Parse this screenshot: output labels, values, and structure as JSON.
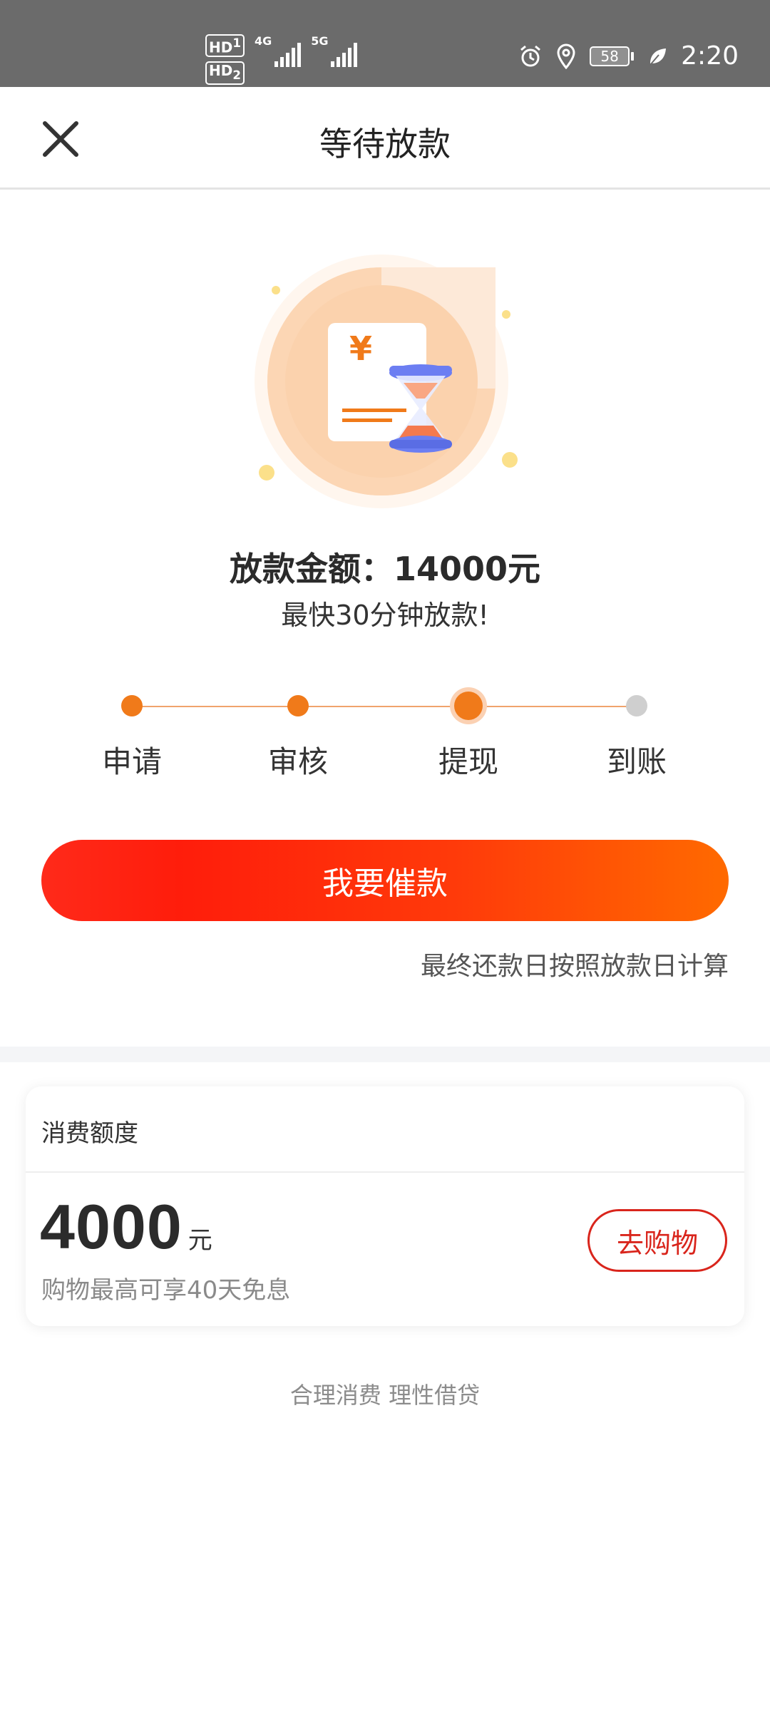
{
  "status_bar": {
    "hd1": "HD",
    "hd1_sub": "1",
    "hd2": "HD",
    "hd2_sub": "2",
    "net1": "4G",
    "net2": "5G",
    "battery": "58",
    "time": "2:20",
    "icons": [
      "alarm-icon",
      "location-icon",
      "battery-icon",
      "leaf-icon"
    ]
  },
  "header": {
    "title": "等待放款",
    "close_icon": "close-icon"
  },
  "loan": {
    "amount_title": "放款金额：14000元",
    "subtitle": "最快30分钟放款!",
    "illustration_symbol": "¥"
  },
  "steps": [
    {
      "label": "申请",
      "state": "done"
    },
    {
      "label": "审核",
      "state": "done"
    },
    {
      "label": "提现",
      "state": "current"
    },
    {
      "label": "到账",
      "state": "pending"
    }
  ],
  "actions": {
    "urge_label": "我要催款",
    "repay_note": "最终还款日按照放款日计算"
  },
  "credit": {
    "title": "消费额度",
    "amount": "4000",
    "unit": "元",
    "desc": "购物最高可享40天免息",
    "shop_label": "去购物"
  },
  "footer": {
    "slogan": "合理消费 理性借贷"
  },
  "colors": {
    "primary": "#f07a1a",
    "button_start": "#ff1d0b",
    "button_end": "#ff6a00",
    "shop_red": "#d9251c"
  }
}
